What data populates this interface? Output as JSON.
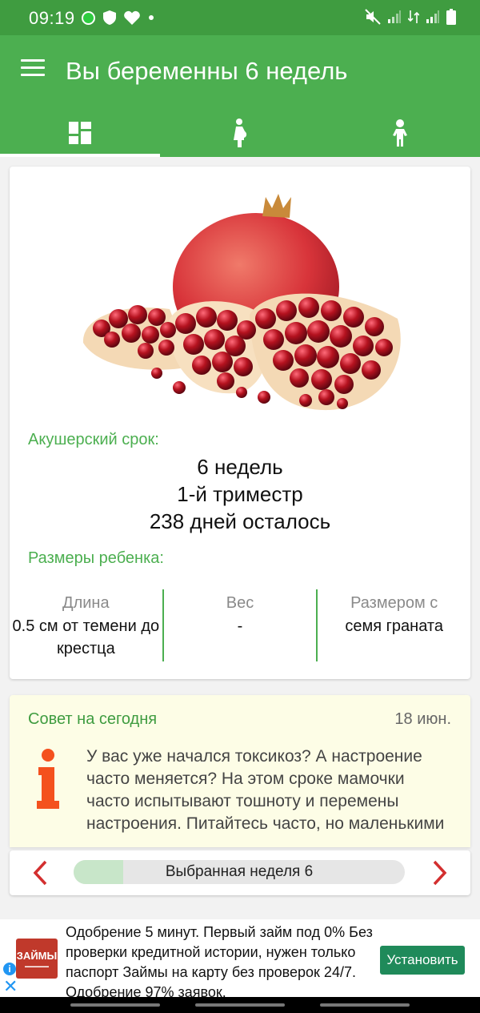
{
  "status_bar": {
    "time": "09:19"
  },
  "app_bar": {
    "title": "Вы беременны 6 недель",
    "tabs": [
      {
        "icon": "dashboard-icon",
        "active": true
      },
      {
        "icon": "pregnant-woman-icon",
        "active": false
      },
      {
        "icon": "baby-icon",
        "active": false
      }
    ]
  },
  "week_card": {
    "image": "pomegranate",
    "term_label": "Акушерский срок:",
    "weeks": "6 недель",
    "trimester": "1-й триместр",
    "days_left": "238 дней осталось",
    "sizes_label": "Размеры ребенка:",
    "sizes": [
      {
        "label": "Длина",
        "value": "0.5 см от темени до крестца"
      },
      {
        "label": "Вес",
        "value": "-"
      },
      {
        "label": "Размером с",
        "value": "семя граната"
      }
    ]
  },
  "tip": {
    "title": "Совет на сегодня",
    "date": "18 июн.",
    "text": "У вас уже начался токсикоз? А настроение часто меняется? На этом сроке мамочки часто испытывают тошноту и перемены настроения. Питайтесь часто, но маленькими"
  },
  "week_selector": {
    "label": "Выбранная неделя 6",
    "progress_fraction": 0.15
  },
  "ad": {
    "logo_text": "ЗАЙМЫ",
    "text": "Одобрение 5 минут. Первый займ под 0% Без проверки кредитной истории, нужен только паспорт Займы на карту без проверок 24/7. Одобрение 97% заявок.",
    "button": "Установить"
  },
  "colors": {
    "primary": "#4caf50",
    "primary_dark": "#3f9c40",
    "accent_red": "#d32f2f",
    "tip_bg": "#fdfde6"
  }
}
